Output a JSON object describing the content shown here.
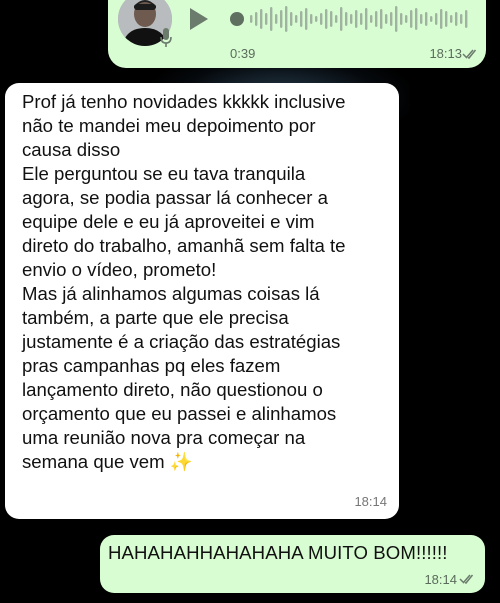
{
  "colors": {
    "outgoing_bubble": "#d9fdd3",
    "incoming_bubble": "#ffffff",
    "background": "#000000",
    "read_ticks": "#6b7b6c"
  },
  "voice_message": {
    "duration": "0:39",
    "time": "18:13",
    "status_icon": "double-check-icon",
    "play_icon": "play-icon",
    "mic_icon": "mic-icon"
  },
  "incoming_message": {
    "text": "Prof já tenho novidades kkkkk inclusive\nnão te mandei meu depoimento por\ncausa disso\nEle perguntou se eu tava tranquila\nagora, se podia passar lá conhecer a\nequipe dele e eu já aproveitei e vim\ndireto do trabalho, amanhã sem falta te\nenvio o vídeo, prometo!\nMas já alinhamos algumas coisas lá\ntambém, a parte que ele precisa\njustamente é a criação das estratégias\npras campanhas pq eles fazem\nlançamento direto, não questionou o\norçamento que eu passei e alinhamos\numa reunião nova pra começar na\nsemana que vem ✨",
    "time": "18:14"
  },
  "outgoing_message": {
    "text": "HAHAHAHHAHAHAHA MUITO BOM!!!!!!",
    "time": "18:14",
    "status_icon": "double-check-icon"
  }
}
